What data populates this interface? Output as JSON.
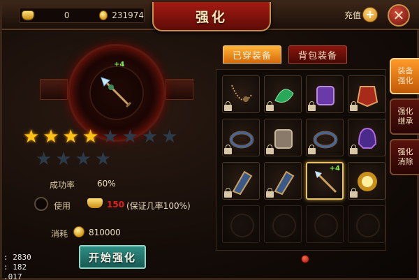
{
  "header": {
    "title": "强化",
    "ingot_count": "0",
    "gold_count": "231974",
    "recharge_label": "充值",
    "plus_label": "+",
    "close_label": "✕"
  },
  "left": {
    "weapon_plus": "+4",
    "stars_filled": 4,
    "stars_total": 12,
    "success_rate_label": "成功率",
    "success_rate_value": "60%",
    "use_label": "使用",
    "use_amount": "150",
    "guarantee_text": "(保证几率100%)",
    "cost_label": "消耗",
    "cost_value": "810000",
    "start_button": "开始强化"
  },
  "debug": {
    "line1": ": 2830",
    "line2": ":  182",
    "line3": ".017"
  },
  "tabs": {
    "equipped": "已穿装备",
    "bag": "背包装备"
  },
  "side_tabs": {
    "enhance": "装备\n强化",
    "inherit": "强化\n继承",
    "remove": "强化\n消除"
  },
  "items": [
    {
      "name": "necklace",
      "locked": true
    },
    {
      "name": "jade-pendant",
      "locked": true
    },
    {
      "name": "boots",
      "locked": true
    },
    {
      "name": "armor",
      "locked": true
    },
    {
      "name": "ring",
      "locked": true
    },
    {
      "name": "belt",
      "locked": true
    },
    {
      "name": "ring",
      "locked": true
    },
    {
      "name": "helmet",
      "locked": true
    },
    {
      "name": "bracer",
      "locked": true
    },
    {
      "name": "bracer",
      "locked": true
    },
    {
      "name": "spear",
      "locked": false,
      "plus": "+4",
      "selected": true
    },
    {
      "name": "medal",
      "locked": true
    }
  ],
  "colors": {
    "accent_gold": "#ffc21a",
    "title_red": "#a41b12",
    "button_teal": "#2f8e84",
    "active_tab_orange": "#ffb43a"
  }
}
